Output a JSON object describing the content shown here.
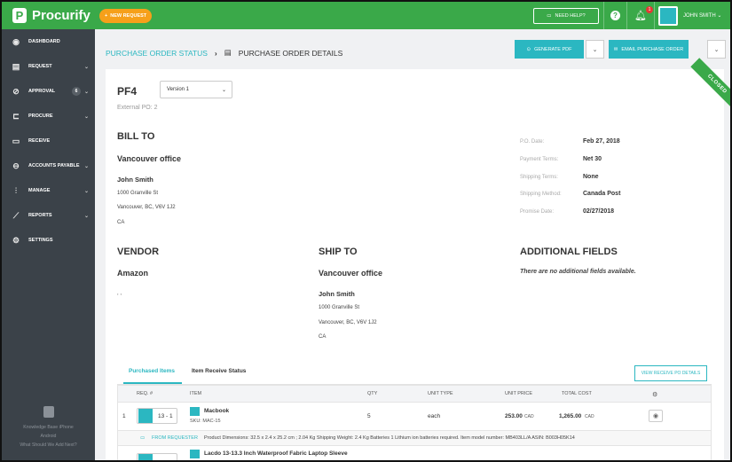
{
  "topbar": {
    "brand": "Procurify",
    "new_request": "NEW REQUEST",
    "need_help": "NEED HELP?",
    "notification_count": "1",
    "user_name": "JOHN SMITH"
  },
  "sidebar": {
    "items": [
      {
        "label": "DASHBOARD",
        "icon": "globe-icon"
      },
      {
        "label": "REQUEST",
        "icon": "request-icon"
      },
      {
        "label": "APPROVAL",
        "icon": "check-circle-icon",
        "badge": "6"
      },
      {
        "label": "PROCURE",
        "icon": "cart-icon"
      },
      {
        "label": "RECEIVE",
        "icon": "truck-icon"
      },
      {
        "label": "ACCOUNTS PAYABLE",
        "icon": "dollar-icon"
      },
      {
        "label": "MANAGE",
        "icon": "sliders-icon"
      },
      {
        "label": "REPORTS",
        "icon": "chart-icon"
      },
      {
        "label": "SETTINGS",
        "icon": "gear-icon"
      }
    ],
    "footer_line1": "Knowledge Base   iPhone",
    "footer_line2": "Android",
    "footer_line3": "What Should We Add Next?"
  },
  "breadcrumb": {
    "parent": "PURCHASE ORDER STATUS",
    "current": "PURCHASE ORDER DETAILS"
  },
  "actions": {
    "generate_pdf": "GENERATE PDF",
    "email_po": "EMAIL PURCHASE ORDER"
  },
  "po": {
    "id": "PF4",
    "version": "Version 1",
    "external_po": "External PO: 2",
    "status_ribbon": "CLOSED"
  },
  "bill_to": {
    "title": "BILL TO",
    "office": "Vancouver office",
    "name": "John Smith",
    "street": "1000 Granville St",
    "city": "Vancouver, BC, V6V 1J2",
    "country": "CA"
  },
  "meta": [
    {
      "key": "P.O. Date:",
      "value": "Feb 27, 2018"
    },
    {
      "key": "Payment Terms:",
      "value": "Net 30"
    },
    {
      "key": "Shipping Terms:",
      "value": "None"
    },
    {
      "key": "Shipping Method:",
      "value": "Canada Post"
    },
    {
      "key": "Promise Date:",
      "value": "02/27/2018"
    }
  ],
  "vendor": {
    "title": "VENDOR",
    "name": "Amazon",
    "detail": ", ,"
  },
  "ship_to": {
    "title": "SHIP TO",
    "office": "Vancouver office",
    "name": "John Smith",
    "street": "1000 Granville St",
    "city": "Vancouver, BC, V6V 1J2",
    "country": "CA"
  },
  "additional": {
    "title": "ADDITIONAL FIELDS",
    "empty": "There are no additional fields available."
  },
  "tabs": {
    "purchased": "Purchased Items",
    "receive_status": "Item Receive Status",
    "view_receive": "VIEW RECEIVE PO DETAILS"
  },
  "table": {
    "headers": [
      "REQ. #",
      "ITEM",
      "QTY",
      "UNIT TYPE",
      "UNIT PRICE",
      "TOTAL COST"
    ],
    "rows": [
      {
        "index": "1",
        "req": "13 - 1",
        "item": "Macbook",
        "sku": "SKU: MAC-15",
        "qty": "5",
        "unit": "each",
        "unit_price": "253.00",
        "unit_price_cur": "CAD",
        "total": "1,265.00",
        "total_cur": "CAD"
      },
      {
        "item": "Lacdo 13-13.3 Inch Waterproof Fabric Laptop Sleeve"
      }
    ],
    "note_label": "FROM REQUESTER",
    "note_text": "Product Dimensions: 32.5 x 2.4 x 25.2 cm ; 2.04 Kg Shipping Weight: 2.4 Kg Batteries 1 Lithium ion batteries required. Item model number: MB403LL/A ASIN: B003H05K14"
  },
  "colors": {
    "brand_green": "#3aa949",
    "accent_teal": "#2bb7c1",
    "sidebar_bg": "#3b4249",
    "new_request_orange": "#f6a01a"
  }
}
